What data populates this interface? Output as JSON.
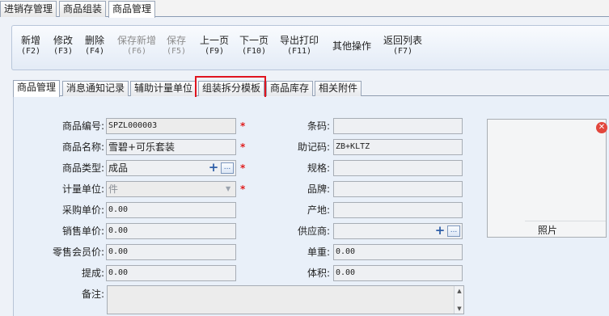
{
  "window_tabs": [
    {
      "label": "进销存管理"
    },
    {
      "label": "商品组装"
    },
    {
      "label": "商品管理"
    }
  ],
  "toolbar": {
    "buttons": [
      {
        "label": "新增",
        "key": "(F2)"
      },
      {
        "label": "修改",
        "key": "(F3)"
      },
      {
        "label": "删除",
        "key": "(F4)"
      },
      {
        "label": "保存新增",
        "key": "(F6)"
      },
      {
        "label": "保存",
        "key": "(F5)"
      },
      {
        "label": "上一页",
        "key": "(F9)"
      },
      {
        "label": "下一页",
        "key": "(F10)"
      },
      {
        "label": "导出打印",
        "key": "(F11)"
      },
      {
        "label": "其他操作",
        "key": ""
      },
      {
        "label": "返回列表",
        "key": "(F7)"
      }
    ]
  },
  "inner_tabs": [
    {
      "label": "商品管理"
    },
    {
      "label": "消息通知记录"
    },
    {
      "label": "辅助计量单位"
    },
    {
      "label": "组装拆分模板"
    },
    {
      "label": "商品库存"
    },
    {
      "label": "相关附件"
    }
  ],
  "form": {
    "code": {
      "label": "商品编号:",
      "value": "SPZL000003"
    },
    "name": {
      "label": "商品名称:",
      "value": "雪碧+可乐套装"
    },
    "type": {
      "label": "商品类型:",
      "value": "成品"
    },
    "unit": {
      "label": "计量单位:",
      "value": "件"
    },
    "purchase_price": {
      "label": "采购单价:",
      "value": "0.00"
    },
    "sale_price": {
      "label": "销售单价:",
      "value": "0.00"
    },
    "member_price": {
      "label": "零售会员价:",
      "value": "0.00"
    },
    "commission": {
      "label": "提成:",
      "value": "0.00"
    },
    "memo": {
      "label": "备注:",
      "value": ""
    },
    "barcode": {
      "label": "条码:",
      "value": ""
    },
    "mnemonic": {
      "label": "助记码:",
      "value": "ZB+KLTZ"
    },
    "spec": {
      "label": "规格:",
      "value": ""
    },
    "brand": {
      "label": "品牌:",
      "value": ""
    },
    "origin": {
      "label": "产地:",
      "value": ""
    },
    "supplier": {
      "label": "供应商:",
      "value": ""
    },
    "unit_weight": {
      "label": "单重:",
      "value": "0.00"
    },
    "volume": {
      "label": "体积:",
      "value": "0.00"
    }
  },
  "required_mark": "*",
  "picker": {
    "plus": "+",
    "dots": "..."
  },
  "photo": {
    "label": "照片"
  },
  "colors": {
    "required": "#e01c1c",
    "highlight_box": "#e0141e",
    "close_icon": "#e2463c"
  },
  "icons": {
    "close": "close-icon",
    "add": "plus-icon",
    "browse": "ellipsis-icon"
  }
}
